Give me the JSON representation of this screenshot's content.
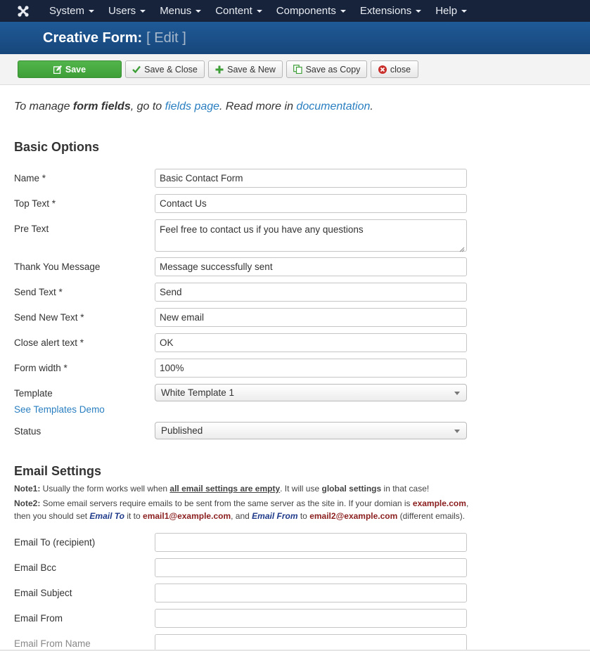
{
  "nav": {
    "items": [
      {
        "label": "System"
      },
      {
        "label": "Users"
      },
      {
        "label": "Menus"
      },
      {
        "label": "Content"
      },
      {
        "label": "Components"
      },
      {
        "label": "Extensions"
      },
      {
        "label": "Help"
      }
    ]
  },
  "header": {
    "title": "Creative Form:",
    "mode": "[ Edit ]"
  },
  "toolbar": {
    "save_label": "Save",
    "save_close_label": "Save & Close",
    "save_new_label": "Save & New",
    "save_copy_label": "Save as Copy",
    "close_label": "close"
  },
  "intro": {
    "prefix": "To manage ",
    "bold": "form fields",
    "mid": ", go to ",
    "fields_link": "fields page",
    "mid2": ". Read more in ",
    "doc_link": "documentation",
    "suffix": "."
  },
  "basic": {
    "title": "Basic Options",
    "name_label": "Name *",
    "name_value": "Basic Contact Form",
    "top_text_label": "Top Text *",
    "top_text_value": "Contact Us",
    "pre_text_label": "Pre Text",
    "pre_text_value": "Feel free to contact us if you have any questions",
    "thank_label": "Thank You Message",
    "thank_value": "Message successfully sent",
    "send_label": "Send Text *",
    "send_value": "Send",
    "send_new_label": "Send New Text *",
    "send_new_value": "New email",
    "close_alert_label": "Close alert text *",
    "close_alert_value": "OK",
    "width_label": "Form width *",
    "width_value": "100%",
    "template_label": "Template",
    "template_value": "White Template 1",
    "templates_demo_link": "See Templates Demo",
    "status_label": "Status",
    "status_value": "Published"
  },
  "email": {
    "title": "Email Settings",
    "note1_label": "Note1:",
    "note1_a": " Usually the form works well when ",
    "note1_u": "all email settings are empty",
    "note1_b": ". It will use ",
    "note1_bold": "global settings",
    "note1_c": " in that case!",
    "note2_label": "Note2:",
    "note2_a": " Some email servers require emails to be sent from the same server as the site in. If your domian is ",
    "note2_domain": "example.com",
    "note2_b": ",",
    "note2_line2_a": " then you should set ",
    "note2_to": "Email To",
    "note2_line2_b": " it to ",
    "note2_email1": "email1@example.com",
    "note2_line2_c": ", and ",
    "note2_from": "Email From",
    "note2_line2_d": " to ",
    "note2_email2": "email2@example.com",
    "note2_line2_e": " (different emails).",
    "to_label": "Email To (recipient)",
    "bcc_label": "Email Bcc",
    "subject_label": "Email Subject",
    "from_label": "Email From",
    "from_name_label": "Email From Name"
  },
  "colors": {
    "nav_bg": "#17233b",
    "title_bg": "#1f5a97",
    "save_green": "#46a83f",
    "link_blue": "#2a7fc1",
    "note_red": "#8b1e1e"
  }
}
